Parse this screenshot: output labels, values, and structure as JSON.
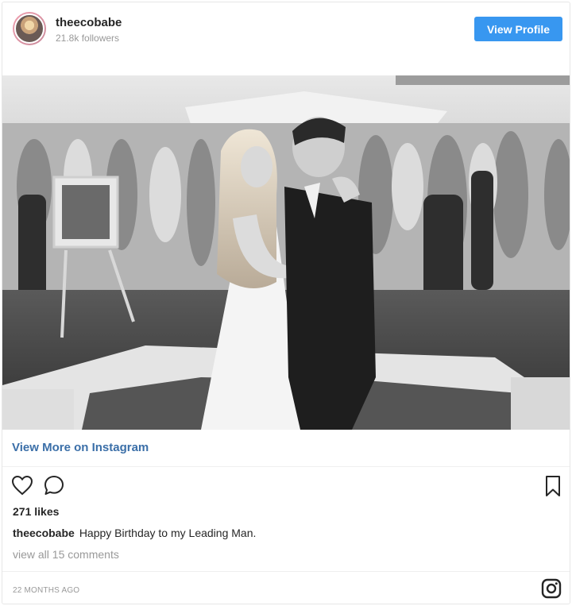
{
  "header": {
    "username": "theecobabe",
    "followers": "21.8k followers",
    "view_profile_label": "View Profile"
  },
  "post": {
    "image_alt": "Black and white wedding photo of a couple dancing in front of guests",
    "view_more_label": "View More on Instagram",
    "likes": "271 likes",
    "caption_user": "theecobabe",
    "caption_text": "Happy Birthday to my Leading Man.",
    "comments_link": "view all 15 comments",
    "timestamp": "22 MONTHS AGO"
  },
  "icons": {
    "like": "heart-icon",
    "comment": "comment-icon",
    "save": "bookmark-icon",
    "brand": "instagram-icon"
  },
  "colors": {
    "accent": "#3897f0",
    "link": "#3b6fa8",
    "muted": "#999999"
  }
}
